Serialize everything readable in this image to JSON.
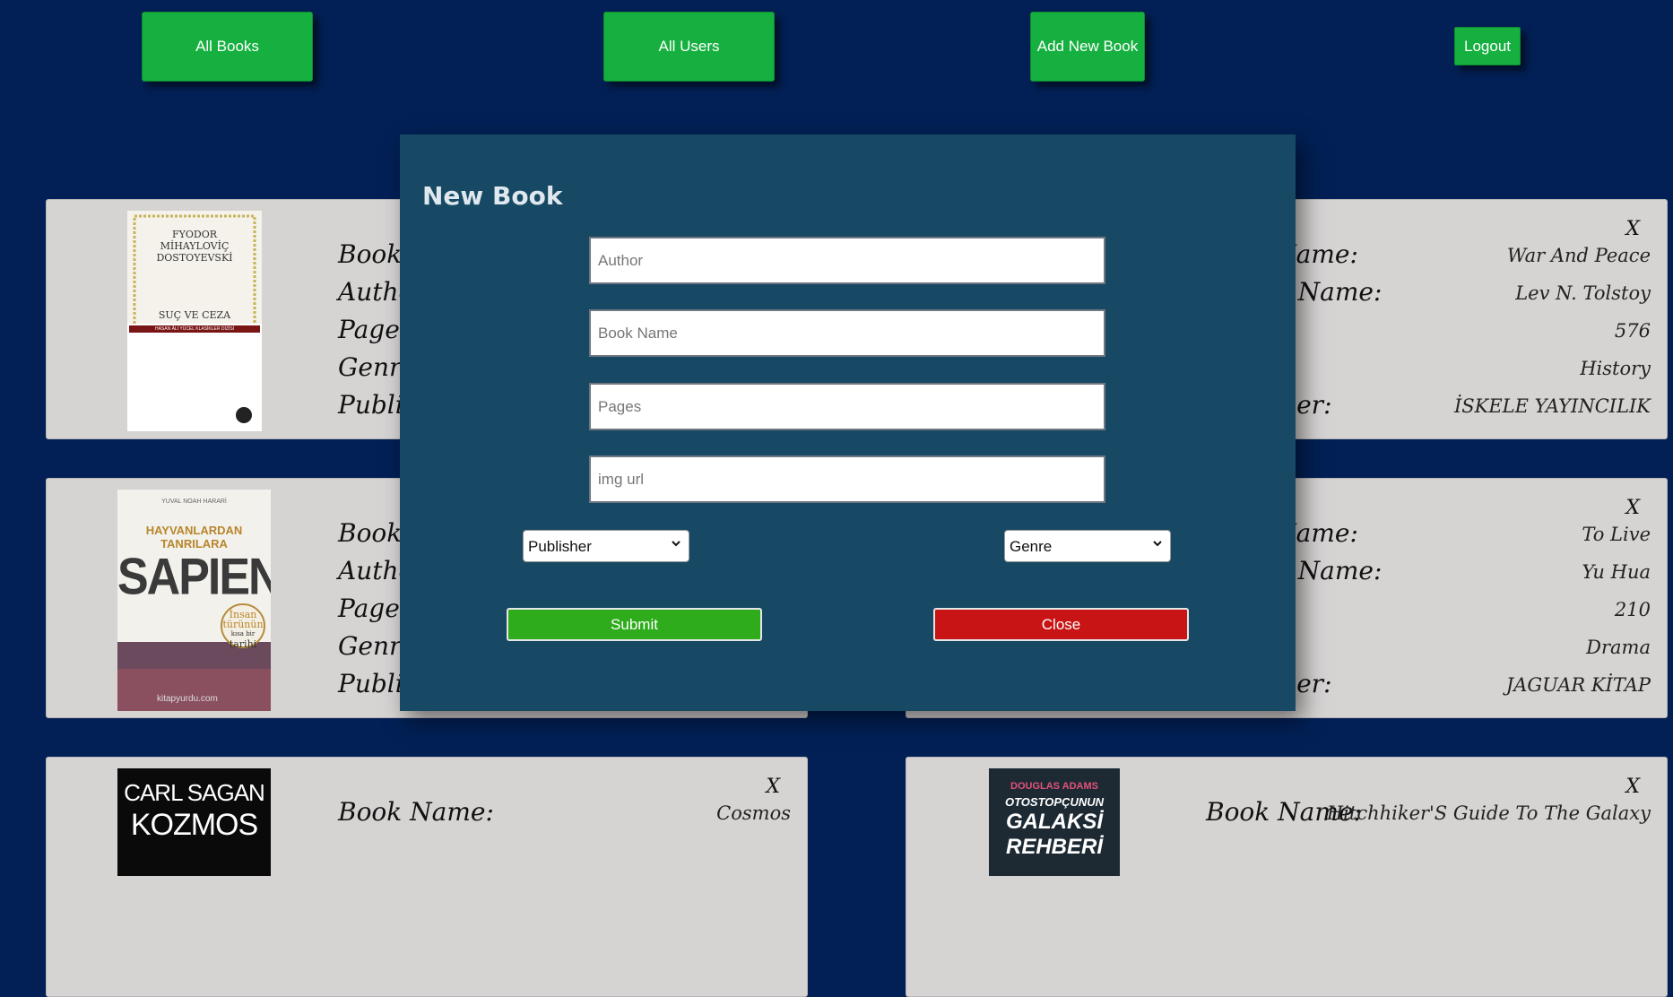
{
  "nav": {
    "all_books": "All Books",
    "all_users": "All Users",
    "add_new_book": "Add New Book",
    "logout": "Logout"
  },
  "labels": {
    "book_name": "Book Name:",
    "author_name": "Author Name:",
    "pages": "Pages:",
    "genre": "Genre:",
    "publisher": "Publisher:",
    "delete": "X"
  },
  "books": [
    {
      "name": "Suç ve Ceza",
      "author": "",
      "pages": "",
      "genre": "",
      "publisher": "",
      "cover": {
        "lines": [
          "FYODOR",
          "MİHAYLOVİÇ",
          "DOSTOYEVSKİ",
          "SUÇ VE CEZA",
          "HASAN ÂLİ YÜCEL KLASİKLER DİZİSİ"
        ],
        "bg": "#f4f2ea"
      }
    },
    {
      "name": "War And Peace",
      "author": "Lev N. Tolstoy",
      "pages": "576",
      "genre": "History",
      "publisher": "İSKELE YAYINCILIK"
    },
    {
      "name": "Sapiens",
      "author": "",
      "pages": "",
      "genre": "",
      "publisher": "",
      "cover": {
        "lines": [
          "YUVAL NOAH HARARİ",
          "HAYVANLARDAN",
          "TANRILARA",
          "SAPIENS",
          "İnsan",
          "türünün",
          "kısa bir",
          "tarihi",
          "kitapyurdu.com"
        ],
        "bg": "#f3f1ec"
      }
    },
    {
      "name": "To Live",
      "author": "Yu Hua",
      "pages": "210",
      "genre": "Drama",
      "publisher": "JAGUAR KİTAP"
    },
    {
      "name": "Cosmos",
      "author": "",
      "pages": "",
      "genre": "",
      "publisher": "",
      "cover": {
        "lines": [
          "CARL SAGAN",
          "KOZMOS"
        ],
        "bg": "#0a0a0a"
      }
    },
    {
      "name": "Hitchhiker'S Guide To The Galaxy",
      "author": "",
      "pages": "",
      "genre": "",
      "publisher": "",
      "cover": {
        "lines": [
          "DOUGLAS ADAMS",
          "OTOSTOPÇUNUN",
          "GALAKSİ",
          "REHBERİ"
        ],
        "bg": "#1d2a33"
      }
    }
  ],
  "modal": {
    "title": "New Book",
    "author_placeholder": "Author",
    "book_name_placeholder": "Book Name",
    "pages_placeholder": "Pages",
    "img_url_placeholder": "img url",
    "publisher_select": "Publisher",
    "genre_select": "Genre",
    "submit": "Submit",
    "close": "Close"
  },
  "colors": {
    "page_bg": "#022055",
    "nav_green": "#16b040",
    "card_bg": "#d6d4d3",
    "modal_bg": "#184964",
    "submit_green": "#2eac1c",
    "close_red": "#c81414"
  },
  "icons": {
    "select_caret": "chevron-down-icon"
  }
}
